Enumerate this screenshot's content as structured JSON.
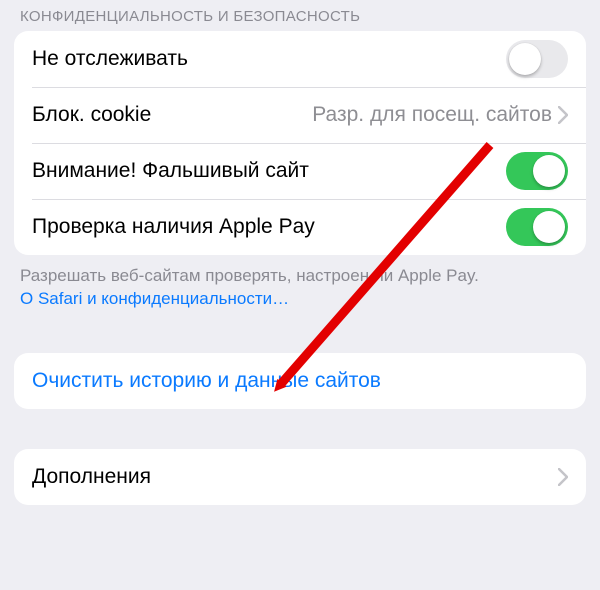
{
  "section": {
    "header": "КОНФИДЕНЦИАЛЬНОСТЬ И БЕЗОПАСНОСТЬ",
    "rows": {
      "do_not_track": {
        "label": "Не отслеживать",
        "on": false
      },
      "block_cookie": {
        "label": "Блок. cookie",
        "value": "Разр. для посещ. сайтов"
      },
      "fraud_warning": {
        "label": "Внимание! Фальшивый сайт",
        "on": true
      },
      "apple_pay_check": {
        "label": "Проверка наличия Apple Pay",
        "on": true
      }
    },
    "footer": {
      "text": "Разрешать веб-сайтам проверять, настроен ли Apple Pay. ",
      "link": "О Safari и конфиденциальности…"
    }
  },
  "clear": {
    "label": "Очистить историю и данные сайтов"
  },
  "extras": {
    "label": "Дополнения"
  }
}
